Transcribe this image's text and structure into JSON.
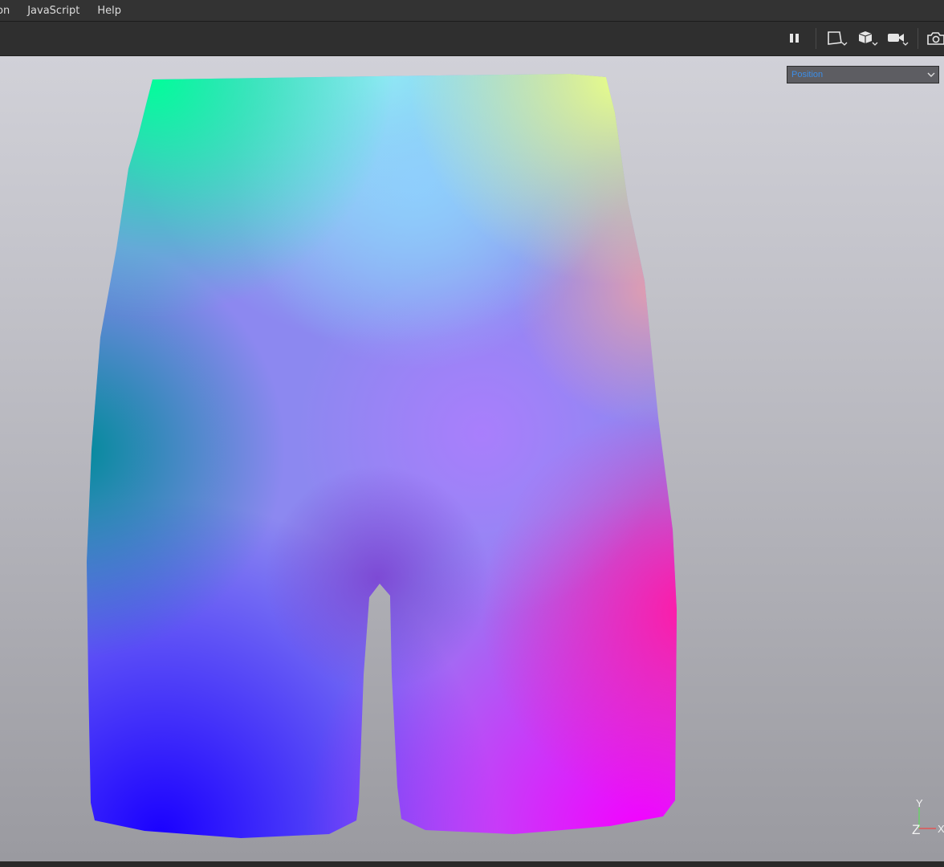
{
  "menubar": {
    "items": [
      {
        "label": "on"
      },
      {
        "label": "JavaScript"
      },
      {
        "label": "Help"
      }
    ]
  },
  "toolbar": {
    "icons": [
      "pause-icon",
      "frame-view-icon",
      "cube-view-icon",
      "camera-video-icon",
      "screenshot-camera-icon"
    ]
  },
  "viewport": {
    "shading_dropdown": {
      "value": "Position"
    },
    "axis_gizmo": {
      "y": "Y",
      "z": "Z",
      "x": "X"
    }
  },
  "colors": {
    "accent": "#3c8ee8",
    "menubar_bg": "#333333",
    "toolbar_bg": "#2f2f2f"
  }
}
